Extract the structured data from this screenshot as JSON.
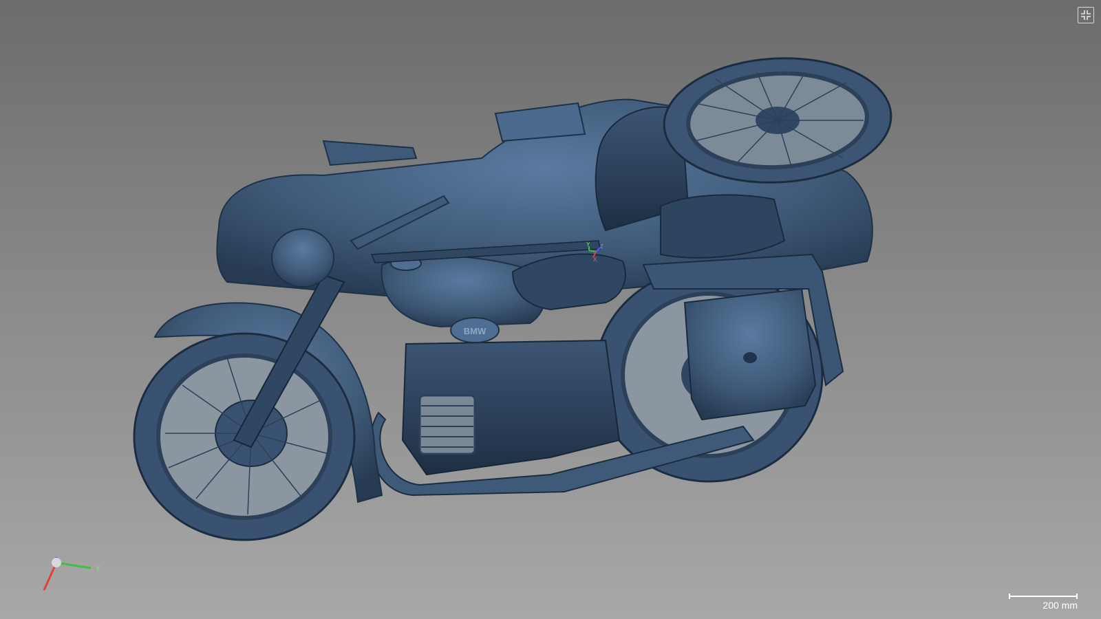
{
  "viewer": {
    "fullscreen_icon": "fullscreen-exit-icon",
    "scale_bar": {
      "label": "200 mm"
    },
    "axis_triad": {
      "y_label": "Y"
    },
    "origin_marker": {
      "y_label": "Y",
      "z_label": "Z",
      "x_label": "X"
    },
    "model": {
      "badge_text": "BMW",
      "color": "#3f5a78"
    },
    "colors": {
      "background_top": "#6c6c6c",
      "background_bottom": "#a8a8a8",
      "model": "#3f5a78",
      "axis_x": "#e04040",
      "axis_y": "#40c040",
      "axis_z": "#5060ff"
    }
  }
}
